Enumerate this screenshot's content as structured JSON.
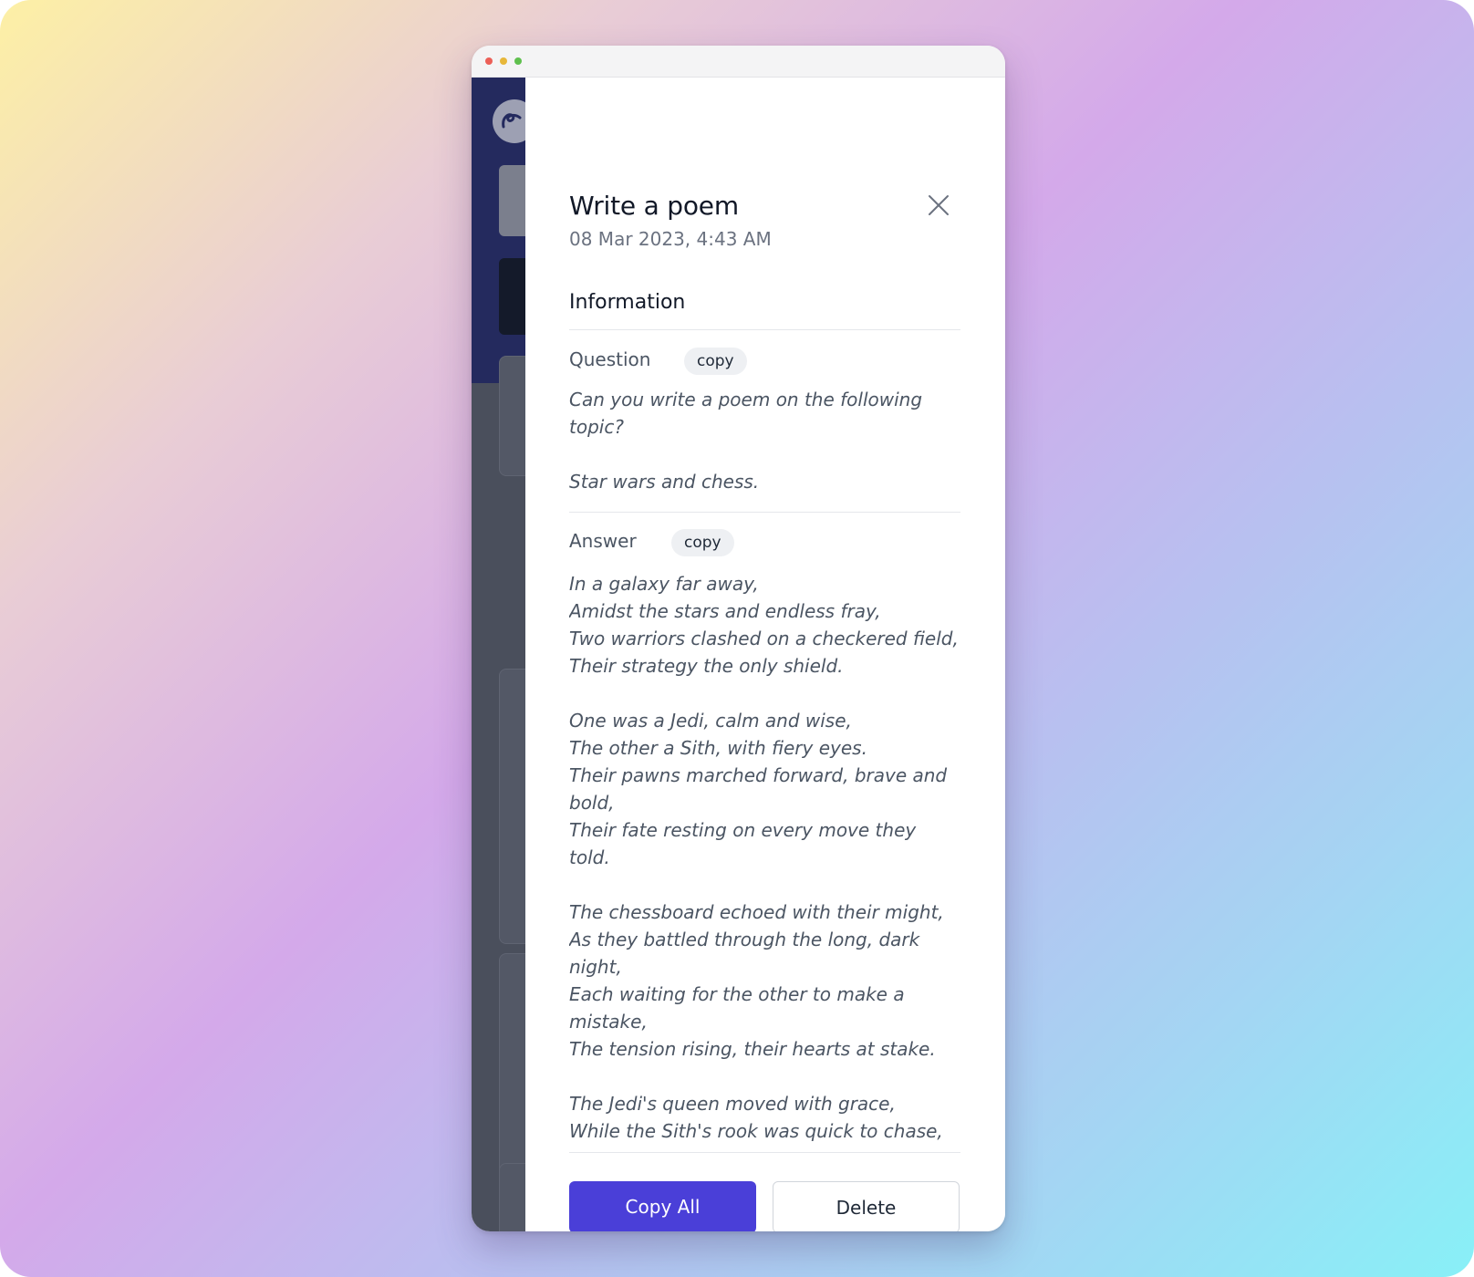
{
  "modal": {
    "title": "Write a poem",
    "datetime": "08 Mar 2023, 4:43 AM",
    "section_heading": "Information",
    "close_icon": "close-icon",
    "question": {
      "label": "Question",
      "copy_label": "copy",
      "text": "Can you write a poem on the following\ntopic?\n\nStar wars and chess."
    },
    "answer": {
      "label": "Answer",
      "copy_label": "copy",
      "text": "In a galaxy far away,\nAmidst the stars and endless fray,\nTwo warriors clashed on a checkered field,\nTheir strategy the only shield.\n\nOne was a Jedi, calm and wise,\nThe other a Sith, with fiery eyes.\nTheir pawns marched forward, brave and\nbold,\nTheir fate resting on every move they told.\n\nThe chessboard echoed with their might,\nAs they battled through the long, dark\nnight,\nEach waiting for the other to make a\nmistake,\nThe tension rising, their hearts at stake.\n\nThe Jedi's queen moved with grace,\nWhile the Sith's rook was quick to chase,\nThe battle raging, the board in flames,"
    },
    "copy_all_label": "Copy All",
    "delete_label": "Delete"
  },
  "colors": {
    "primary": "#4a3fd8",
    "app_header": "#242a5e"
  }
}
